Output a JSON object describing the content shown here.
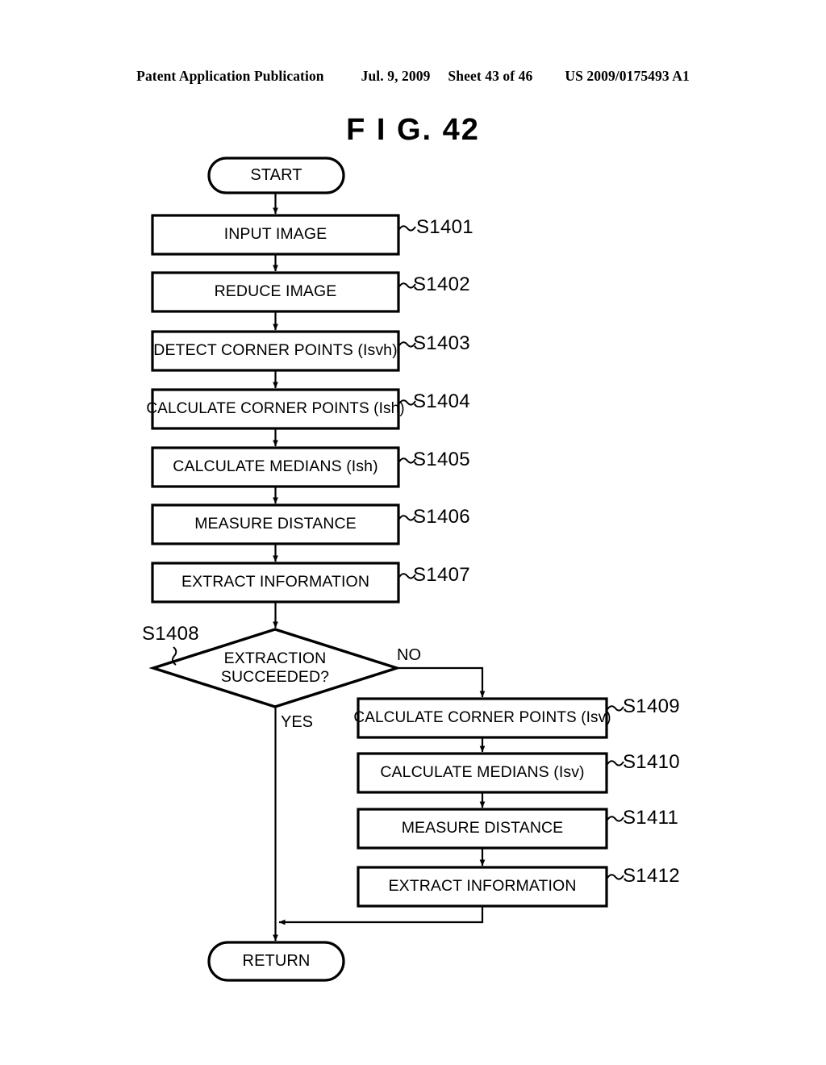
{
  "header": {
    "publication": "Patent Application Publication",
    "date": "Jul. 9, 2009",
    "sheet": "Sheet 43 of 46",
    "patent_number": "US 2009/0175493 A1"
  },
  "figure": {
    "title": "F I G.  42"
  },
  "flowchart": {
    "start": {
      "label": "START"
    },
    "end": {
      "label": "RETURN"
    },
    "main_steps": [
      {
        "label": "INPUT IMAGE",
        "tag": "S1401"
      },
      {
        "label": "REDUCE IMAGE",
        "tag": "S1402"
      },
      {
        "label": "DETECT CORNER POINTS (Isvh)",
        "tag": "S1403"
      },
      {
        "label": "CALCULATE CORNER POINTS (Ish)",
        "tag": "S1404"
      },
      {
        "label": "CALCULATE MEDIANS (Ish)",
        "tag": "S1405"
      },
      {
        "label": "MEASURE DISTANCE",
        "tag": "S1406"
      },
      {
        "label": "EXTRACT INFORMATION",
        "tag": "S1407"
      }
    ],
    "decision": {
      "label_line1": "EXTRACTION",
      "label_line2": "SUCCEEDED?",
      "tag": "S1408",
      "yes_label": "YES",
      "no_label": "NO"
    },
    "branch_steps": [
      {
        "label": "CALCULATE CORNER POINTS (Isv)",
        "tag": "S1409"
      },
      {
        "label": "CALCULATE MEDIANS (Isv)",
        "tag": "S1410"
      },
      {
        "label": "MEASURE DISTANCE",
        "tag": "S1411"
      },
      {
        "label": "EXTRACT INFORMATION",
        "tag": "S1412"
      }
    ]
  },
  "colors": {
    "ink": "#000000",
    "paper": "#ffffff"
  }
}
